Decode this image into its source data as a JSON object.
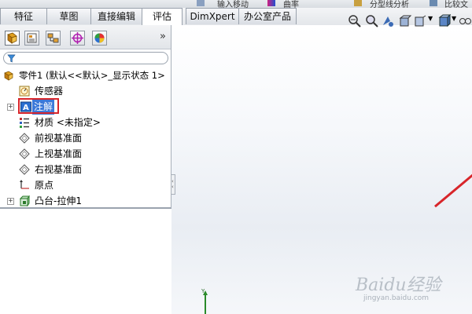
{
  "top_strip": {
    "items": [
      "输入移动",
      "曲率",
      "分型线分析",
      "比较文"
    ]
  },
  "tabs": [
    {
      "label": "特征",
      "active": false
    },
    {
      "label": "草图",
      "active": false
    },
    {
      "label": "直接编辑",
      "active": false
    },
    {
      "label": "评估",
      "active": true
    },
    {
      "label": "DimXpert",
      "active": false
    },
    {
      "label": "办公室产品",
      "active": false
    }
  ],
  "panel": {
    "tool_icons": [
      "feature-manager-icon",
      "property-manager-icon",
      "configuration-manager-icon",
      "dimxpert-manager-icon",
      "display-manager-icon"
    ],
    "more": "»",
    "filter_icon": "funnel-icon"
  },
  "tree": {
    "root": "零件1  (默认<<默认>_显示状态 1>",
    "items": [
      {
        "label": "传感器",
        "icon": "sensor-icon"
      },
      {
        "label": "注解",
        "icon": "annotation-icon",
        "selected": true
      },
      {
        "label": "材质 <未指定>",
        "icon": "material-icon"
      },
      {
        "label": "前视基准面",
        "icon": "plane-icon"
      },
      {
        "label": "上视基准面",
        "icon": "plane-icon"
      },
      {
        "label": "右视基准面",
        "icon": "plane-icon"
      },
      {
        "label": "原点",
        "icon": "origin-icon"
      },
      {
        "label": "凸台-拉伸1",
        "icon": "boss-extrude-icon"
      }
    ]
  },
  "viewport": {
    "axis_label": "Y",
    "watermark_main": "Baidu经验",
    "watermark_url": "jingyan.baidu.com"
  },
  "colors": {
    "highlight": "#3c79d9",
    "annotation_red": "#d8252a",
    "axis_green": "#2a8a2a"
  }
}
